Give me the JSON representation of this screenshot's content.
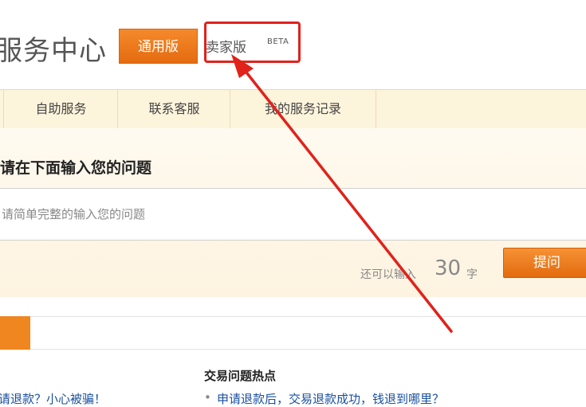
{
  "header": {
    "title": "服务中心",
    "tabs": [
      {
        "label": "通用版",
        "active": true
      },
      {
        "label": "卖家版",
        "badge": "BETA",
        "active": false
      }
    ]
  },
  "nav": {
    "items": [
      "自助服务",
      "联系客服",
      "我的服务记录"
    ]
  },
  "question": {
    "heading": "请在下面输入您的问题",
    "placeholder": "请简单完整的输入您的问题",
    "remaining_label": "还可以输入",
    "remaining_count": "30",
    "remaining_unit": "字",
    "submit_label": "提问"
  },
  "bottom": {
    "left_link": "请退款？小心被骗！",
    "hot_title": "交易问题热点",
    "hot_items": [
      "申请退款后，交易退款成功，钱退到哪里？"
    ]
  },
  "colors": {
    "accent": "#e8731a",
    "annotation": "#e0221b",
    "nav_bg": "#fdf4dc",
    "link": "#1a4fa0"
  }
}
